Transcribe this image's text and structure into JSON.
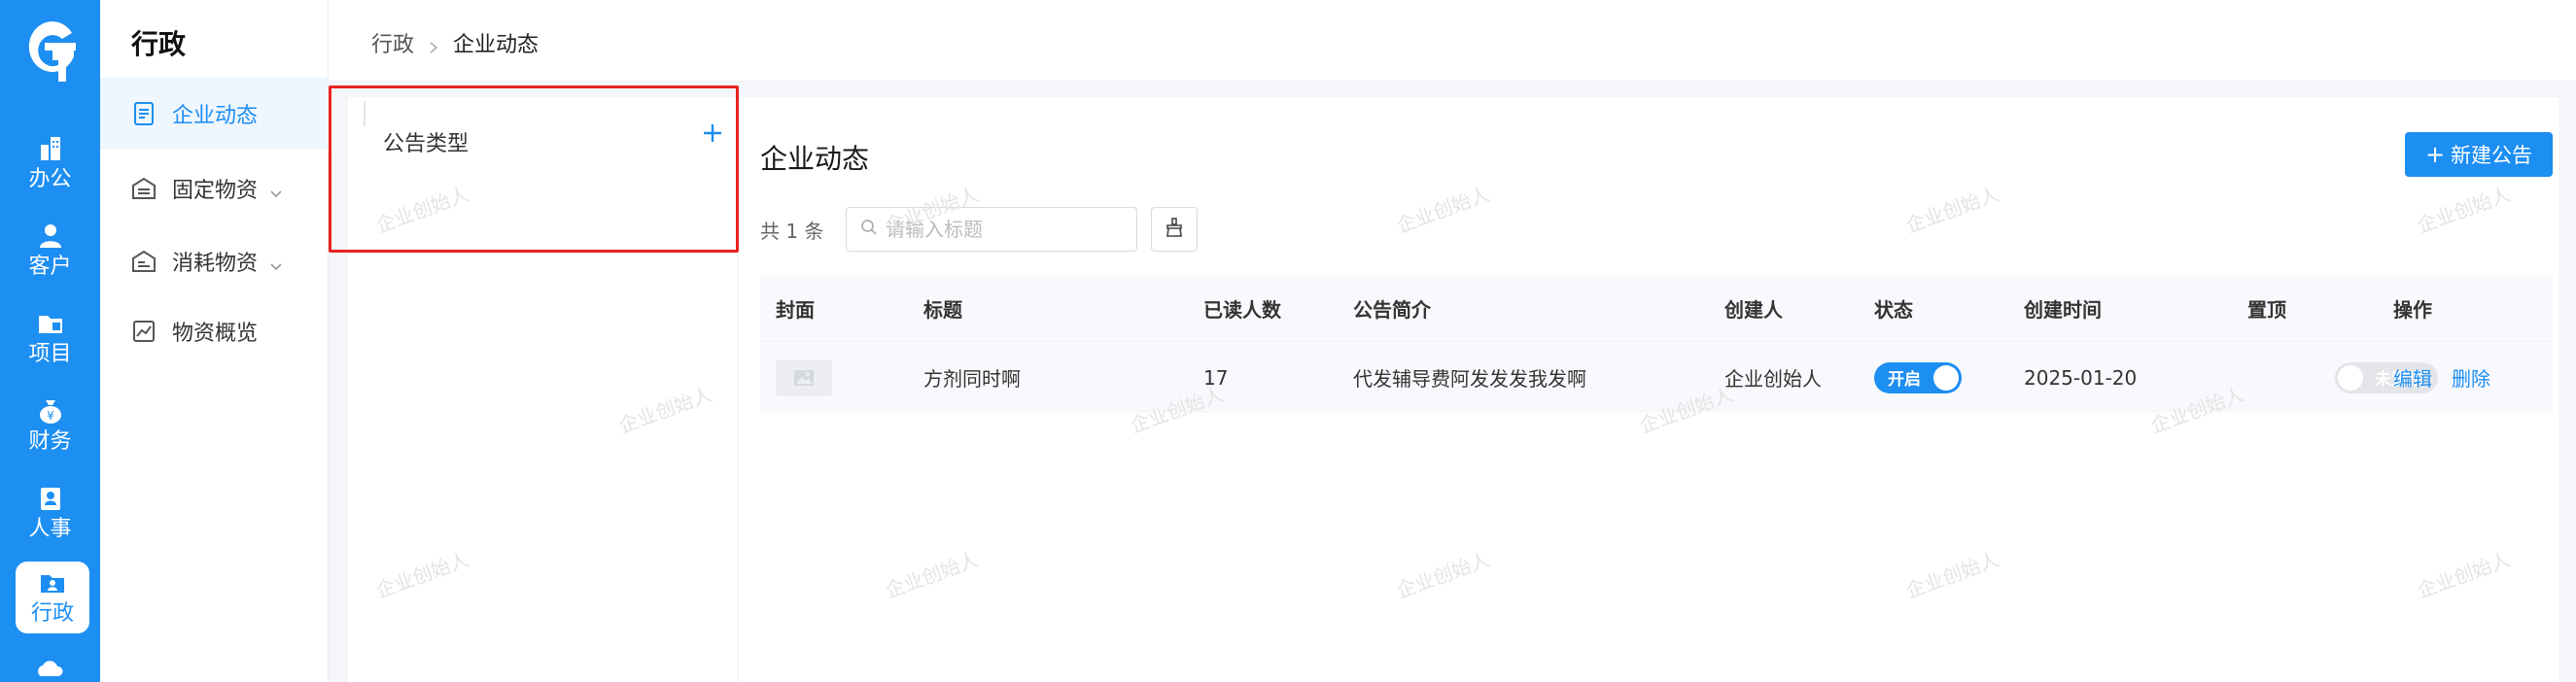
{
  "rail": {
    "logo_icon": "g-logo-icon",
    "items": [
      {
        "label": "办公",
        "icon": "office-building-icon"
      },
      {
        "label": "客户",
        "icon": "customer-user-icon"
      },
      {
        "label": "项目",
        "icon": "project-folder-icon"
      },
      {
        "label": "财务",
        "icon": "finance-moneybag-icon"
      },
      {
        "label": "人事",
        "icon": "personnel-badge-icon"
      },
      {
        "label": "行政",
        "icon": "admin-folder-user-icon",
        "active": true
      }
    ]
  },
  "subnav": {
    "title": "行政",
    "items": [
      {
        "label": "企业动态",
        "icon": "document-icon",
        "active": true
      },
      {
        "label": "固定物资",
        "icon": "warehouse-icon",
        "has_children": true
      },
      {
        "label": "消耗物资",
        "icon": "warehouse-consumable-icon",
        "has_children": true
      },
      {
        "label": "物资概览",
        "icon": "chart-overview-icon"
      }
    ]
  },
  "breadcrumb": {
    "root": "行政",
    "current": "企业动态"
  },
  "type_panel": {
    "title": "公告类型",
    "add_icon": "plus-icon"
  },
  "main": {
    "title": "企业动态",
    "new_button": "新建公告",
    "total_text": "共 1 条",
    "search_placeholder": "请输入标题",
    "clear_icon": "broom-clear-icon",
    "columns": [
      "封面",
      "标题",
      "已读人数",
      "公告简介",
      "创建人",
      "状态",
      "创建时间",
      "置顶",
      "操作"
    ],
    "rows": [
      {
        "cover": "image-placeholder-icon",
        "title": "方剂同时啊",
        "read_count": "17",
        "summary": "代发辅导费阿发发发我发啊",
        "creator": "企业创始人",
        "status": "开启",
        "created": "2025-01-20",
        "pin": "未置顶",
        "edit": "编辑",
        "delete": "删除"
      }
    ]
  },
  "watermark": "企业创始人",
  "colors": {
    "primary": "#1d8ef2",
    "highlight_border": "#e8231f",
    "page_bg": "#f4f6f9"
  }
}
